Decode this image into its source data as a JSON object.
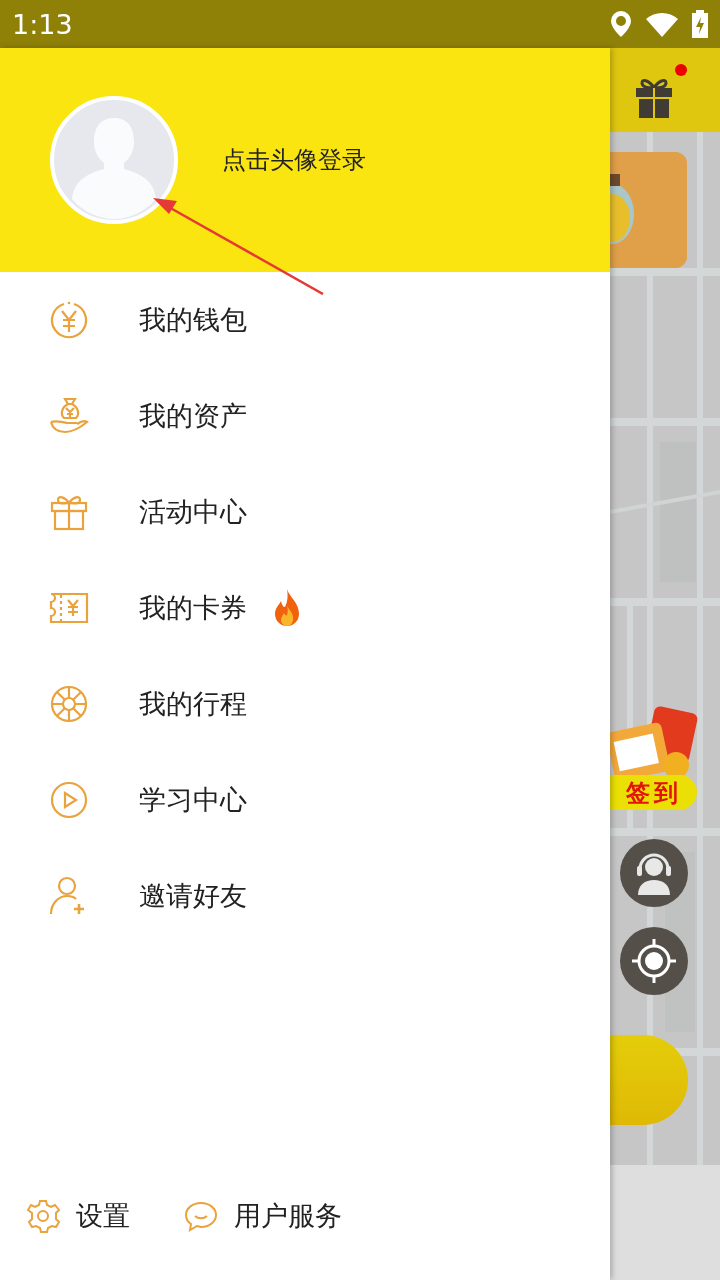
{
  "status_bar": {
    "time": "1:13"
  },
  "drawer": {
    "login_prompt": "点击头像登录",
    "menu": [
      {
        "kind": "wallet",
        "label": "我的钱包",
        "hot": false
      },
      {
        "kind": "assets",
        "label": "我的资产",
        "hot": false
      },
      {
        "kind": "gift",
        "label": "活动中心",
        "hot": false
      },
      {
        "kind": "coupon",
        "label": "我的卡券",
        "hot": true
      },
      {
        "kind": "trips",
        "label": "我的行程",
        "hot": false
      },
      {
        "kind": "learn",
        "label": "学习中心",
        "hot": false
      },
      {
        "kind": "invite",
        "label": "邀请好友",
        "hot": false
      }
    ],
    "footer": [
      {
        "kind": "settings",
        "label": "设置"
      },
      {
        "kind": "service",
        "label": "用户服务"
      }
    ]
  },
  "background": {
    "gift_notification": true,
    "sign_in": "签到"
  }
}
